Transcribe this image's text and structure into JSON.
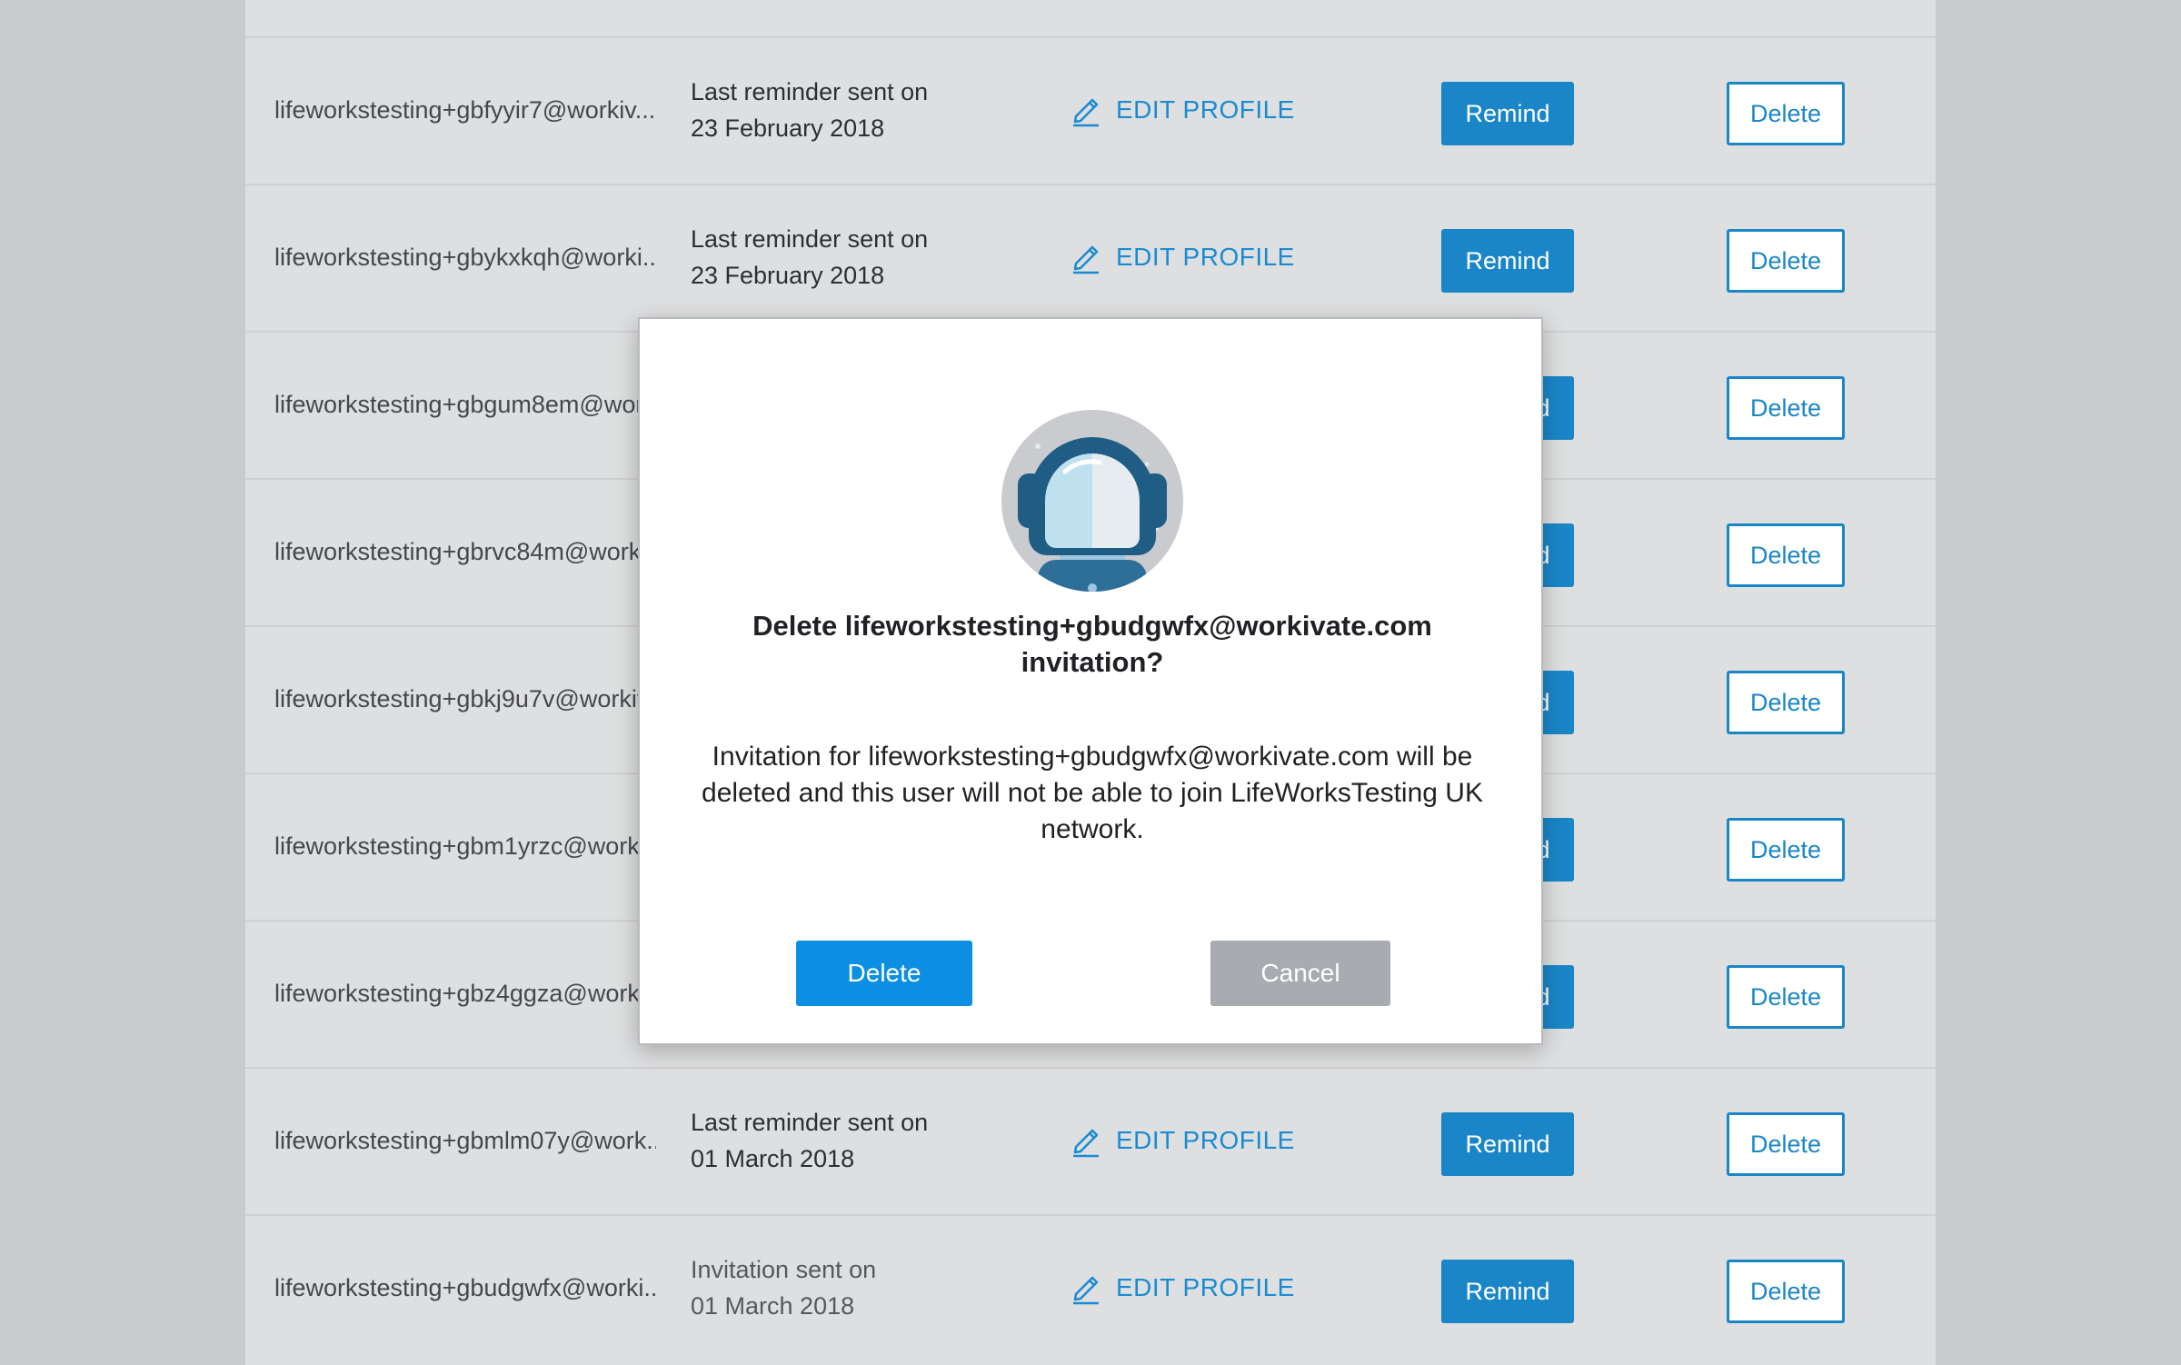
{
  "table": {
    "edit_label": "EDIT PROFILE",
    "remind_label": "Remind",
    "delete_label": "Delete",
    "rows": [
      {
        "email": "lifeworkstesting+gbfyyir7@workiv...",
        "status_line1": "Last reminder sent on",
        "status_line2": "23 February 2018"
      },
      {
        "email": "lifeworkstesting+gbykxkqh@worki...",
        "status_line1": "Last reminder sent on",
        "status_line2": "23 February 2018"
      },
      {
        "email": "lifeworkstesting+gbgum8em@wor...",
        "status_line1": "",
        "status_line2": ""
      },
      {
        "email": "lifeworkstesting+gbrvc84m@worki...",
        "status_line1": "",
        "status_line2": ""
      },
      {
        "email": "lifeworkstesting+gbkj9u7v@workiv...",
        "status_line1": "",
        "status_line2": ""
      },
      {
        "email": "lifeworkstesting+gbm1yrzc@worki...",
        "status_line1": "",
        "status_line2": ""
      },
      {
        "email": "lifeworkstesting+gbz4ggza@worki...",
        "status_line1": "",
        "status_line2": ""
      },
      {
        "email": "lifeworkstesting+gbmlm07y@work...",
        "status_line1": "Last reminder sent on",
        "status_line2": "01 March 2018"
      },
      {
        "email": "lifeworkstesting+gbudgwfx@worki...",
        "status_line1": "Invitation sent on",
        "status_line2": "01 March 2018"
      }
    ]
  },
  "modal": {
    "avatar_icon": "astronaut-helmet-icon",
    "title": "Delete lifeworkstesting+gbudgwfx@workivate.com invitation?",
    "message": "Invitation for lifeworkstesting+gbudgwfx@workivate.com will be deleted and this user will not be able to join LifeWorksTesting UK network.",
    "delete_label": "Delete",
    "cancel_label": "Cancel"
  },
  "colors": {
    "accent": "#1a86c7",
    "modal_delete": "#0c8fe3",
    "cancel": "#a8abaf",
    "overlay_panel": "#dedfe0",
    "page_bg": "#c9cacc"
  }
}
